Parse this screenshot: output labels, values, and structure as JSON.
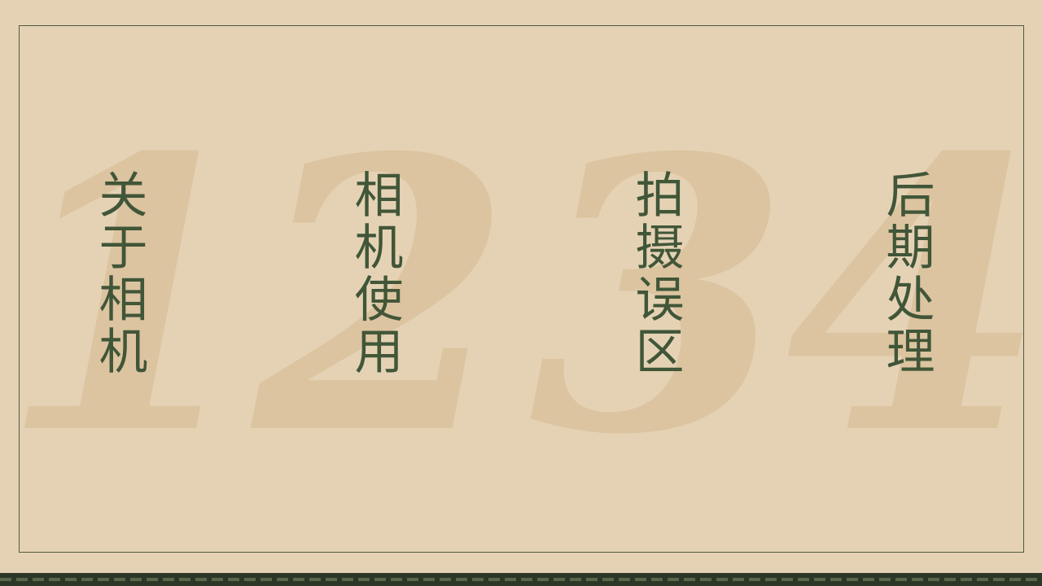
{
  "sections": [
    {
      "numeral": "1",
      "title": "关于相机"
    },
    {
      "numeral": "2",
      "title": "相机使用"
    },
    {
      "numeral": "3",
      "title": "拍摄误区"
    },
    {
      "numeral": "4",
      "title": "后期处理"
    }
  ],
  "colors": {
    "background": "#e5d2b5",
    "numeral": "#dcc4a0",
    "title": "#415638",
    "frame": "#4d5b3e",
    "footer": "#2d3727"
  }
}
